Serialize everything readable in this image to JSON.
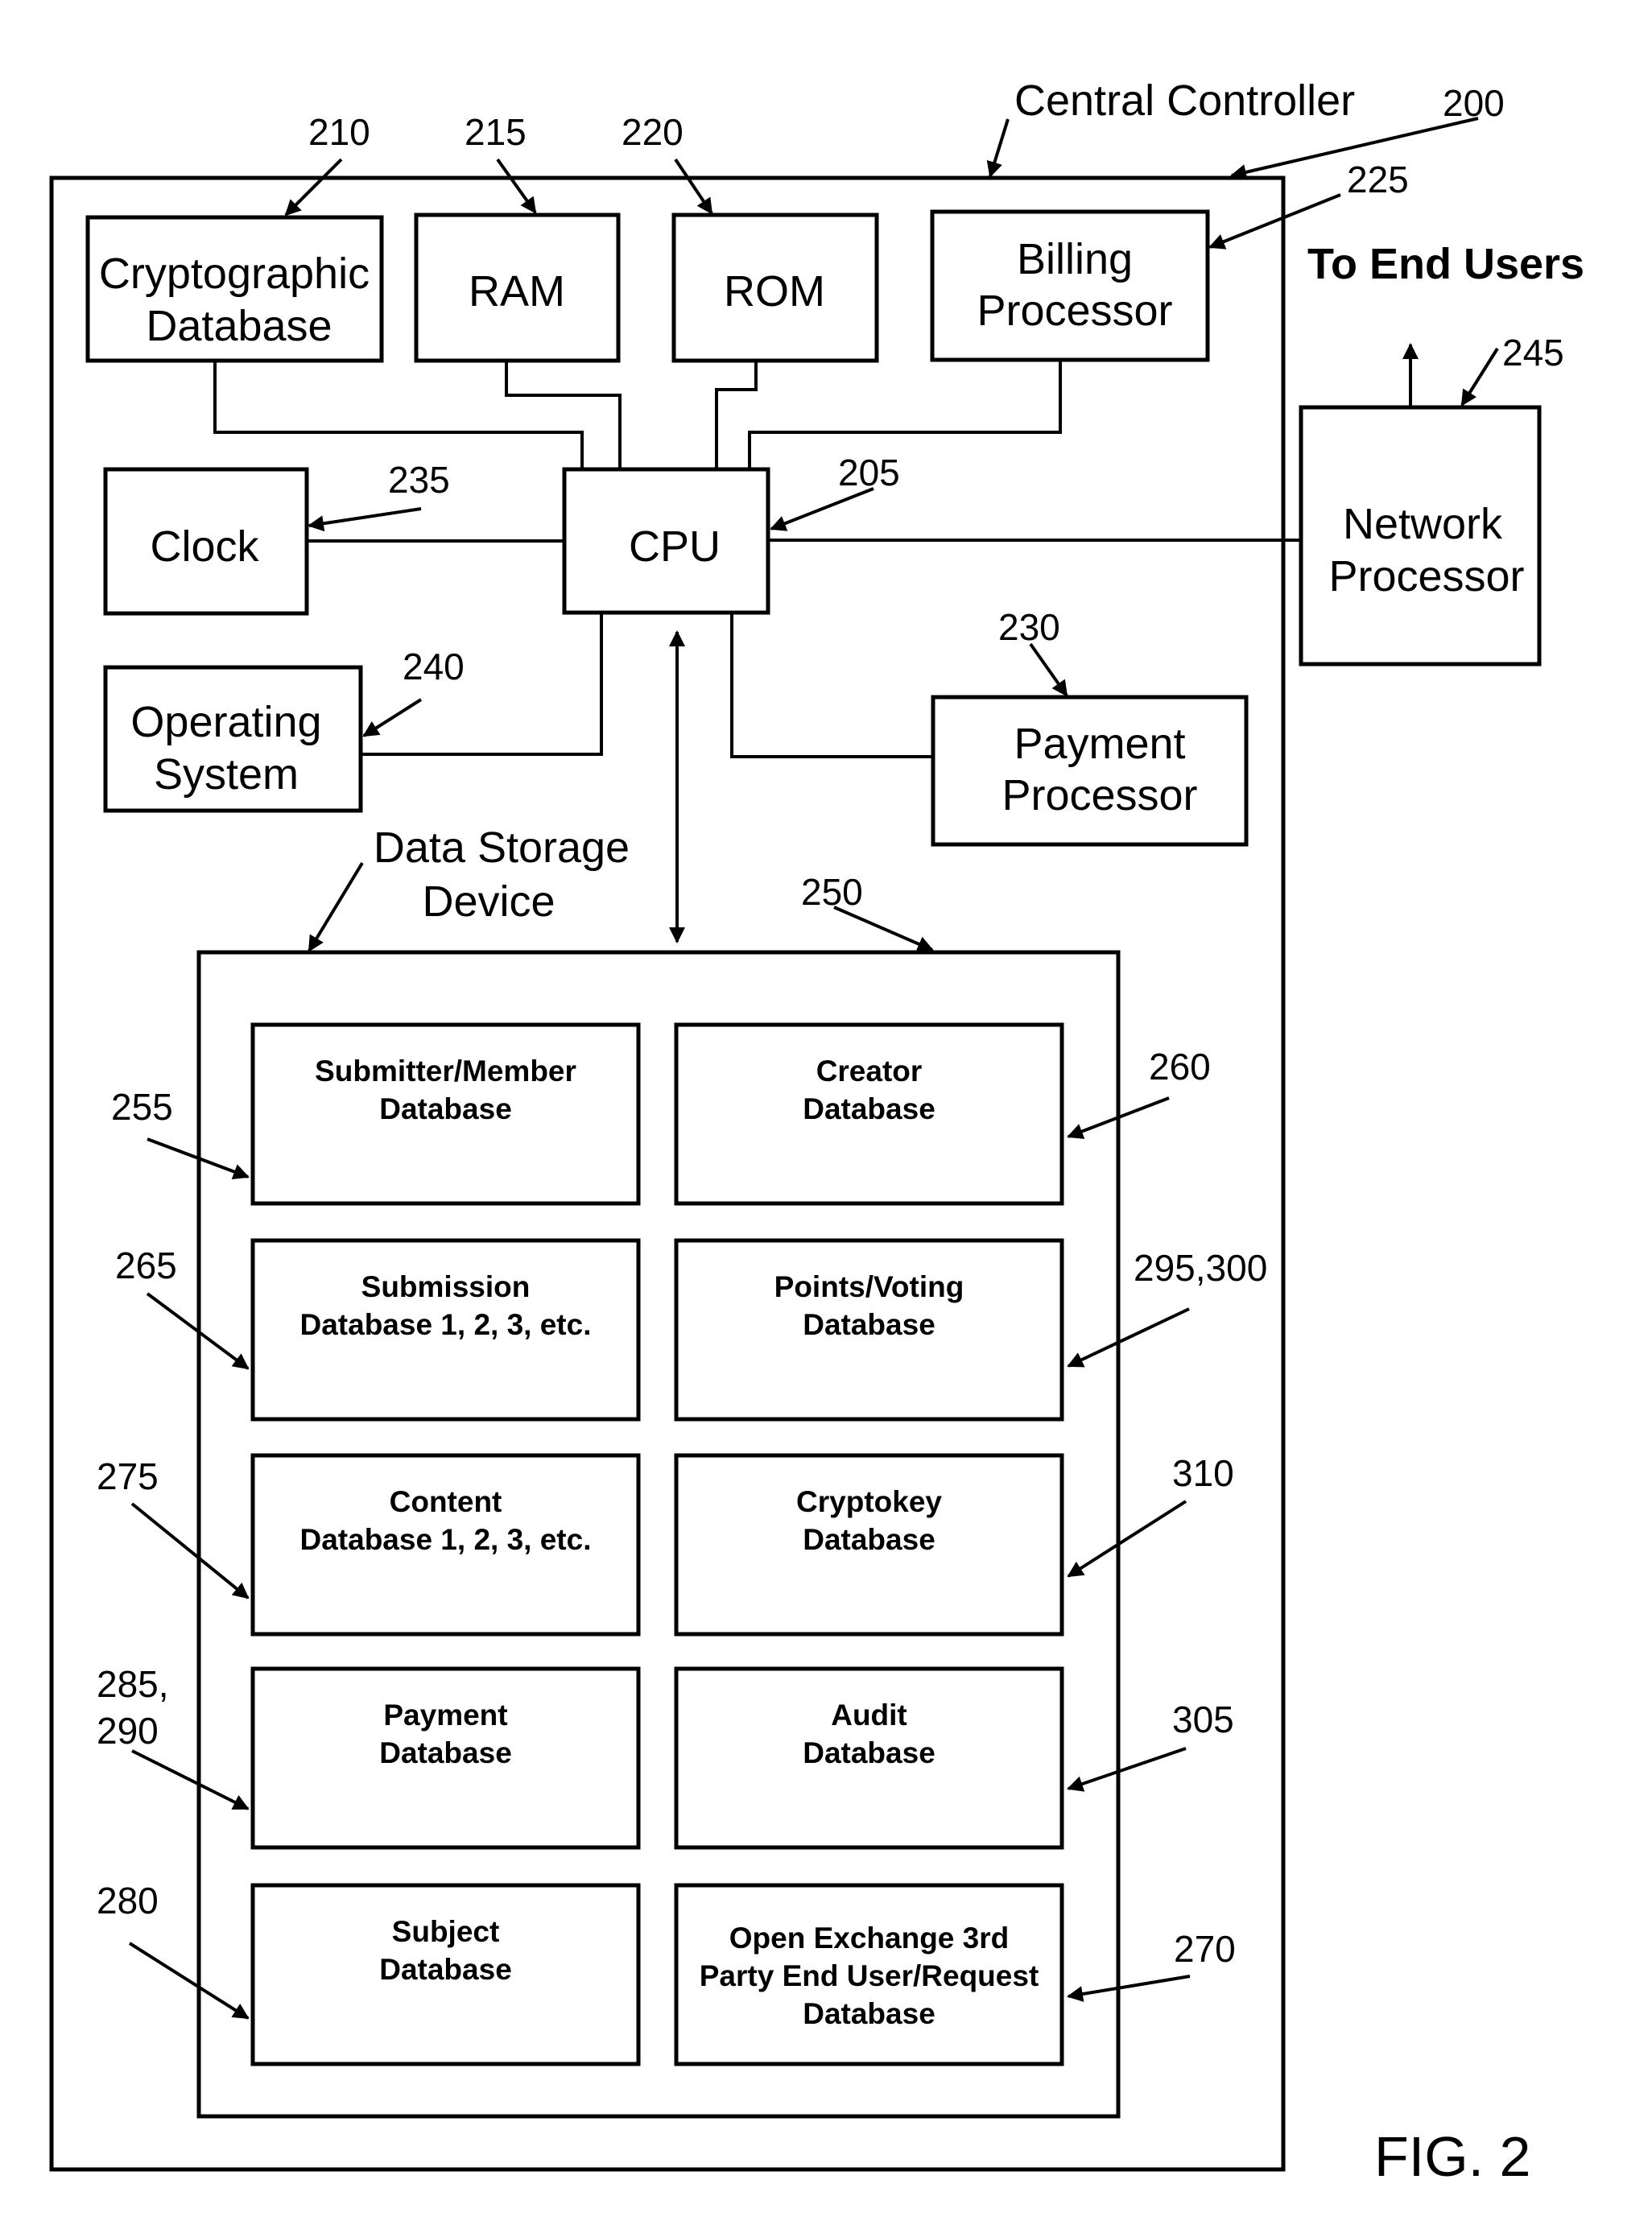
{
  "figure": {
    "label": "FIG. 2",
    "central_controller": {
      "name": "Central Controller",
      "ref": "200"
    },
    "external_label": "To End Users"
  },
  "components": {
    "crypto_db": {
      "lines": [
        "Cryptographic",
        "Database"
      ],
      "ref": "210"
    },
    "ram": {
      "lines": [
        "RAM"
      ],
      "ref": "215"
    },
    "rom": {
      "lines": [
        "ROM"
      ],
      "ref": "220"
    },
    "billing": {
      "lines": [
        "Billing",
        "Processor"
      ],
      "ref": "225"
    },
    "clock": {
      "lines": [
        "Clock"
      ],
      "ref": "235"
    },
    "cpu": {
      "lines": [
        "CPU"
      ],
      "ref": "205"
    },
    "os": {
      "lines": [
        "Operating",
        "System"
      ],
      "ref": "240"
    },
    "payment_processor": {
      "lines": [
        "Payment",
        "Processor"
      ],
      "ref": "230"
    },
    "network_processor": {
      "lines": [
        "Network",
        "Processor"
      ],
      "ref": "245"
    },
    "data_storage": {
      "lines": [
        "Data Storage",
        "Device"
      ],
      "ref": "250"
    }
  },
  "databases": [
    {
      "lines": [
        "Submitter/Member",
        "Database"
      ],
      "ref": [
        "255"
      ]
    },
    {
      "lines": [
        "Creator",
        "Database"
      ],
      "ref": [
        "260"
      ]
    },
    {
      "lines": [
        "Submission",
        "Database 1, 2, 3, etc."
      ],
      "ref": [
        "265"
      ]
    },
    {
      "lines": [
        "Points/Voting",
        "Database"
      ],
      "ref": [
        "295,300"
      ]
    },
    {
      "lines": [
        "Content",
        "Database 1, 2, 3, etc."
      ],
      "ref": [
        "275"
      ]
    },
    {
      "lines": [
        "Cryptokey",
        "Database"
      ],
      "ref": [
        "310"
      ]
    },
    {
      "lines": [
        "Payment",
        "Database"
      ],
      "ref": [
        "285,",
        "290"
      ]
    },
    {
      "lines": [
        "Audit",
        "Database"
      ],
      "ref": [
        "305"
      ]
    },
    {
      "lines": [
        "Subject",
        "Database"
      ],
      "ref": [
        "280"
      ]
    },
    {
      "lines": [
        "Open Exchange 3rd",
        "Party End User/Request",
        "Database"
      ],
      "ref": [
        "270"
      ]
    }
  ]
}
